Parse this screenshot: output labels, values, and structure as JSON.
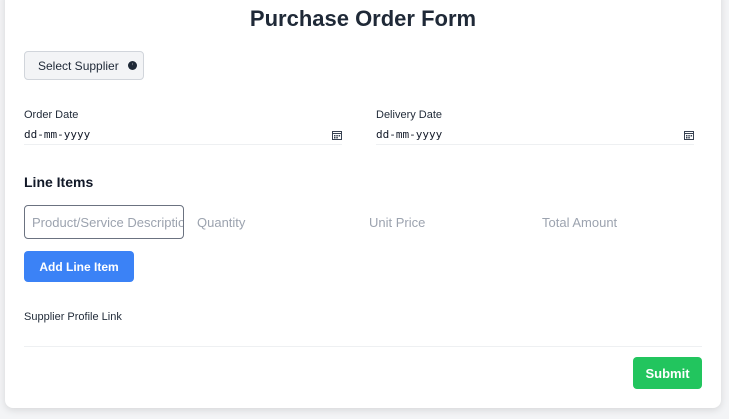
{
  "form": {
    "title": "Purchase Order Form",
    "select_supplier_label": "Select Supplier",
    "order_date_label": "Order Date",
    "order_date_value": "dd-mm-yyyy",
    "delivery_date_label": "Delivery Date",
    "delivery_date_value": "dd-mm-yyyy",
    "line_items_title": "Line Items",
    "line_item": {
      "description_placeholder": "Product/Service Description",
      "quantity_placeholder": "Quantity",
      "unit_price_placeholder": "Unit Price",
      "total_amount_placeholder": "Total Amount"
    },
    "add_line_item_label": "Add Line Item",
    "supplier_profile_link_label": "Supplier Profile Link",
    "supplier_profile_link_value": "",
    "submit_label": "Submit"
  },
  "colors": {
    "primary": "#3b82f6",
    "success": "#22c55e",
    "background": "#f3f4f6"
  },
  "icons": {
    "supplier": "circle-half-icon",
    "date": "calendar-icon"
  }
}
